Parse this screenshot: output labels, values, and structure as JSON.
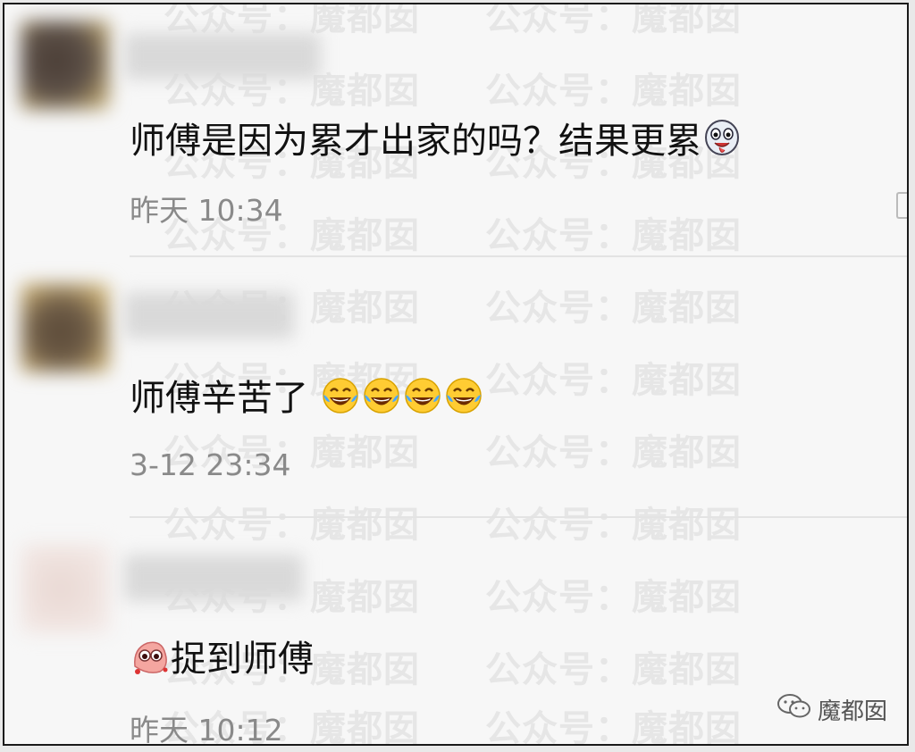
{
  "watermark": "公众号：魔都囡",
  "comments": [
    {
      "text": "师傅是因为累才出家的吗？结果更累",
      "emoji": "ghost-emoji",
      "time": "昨天 10:34"
    },
    {
      "text": "师傅辛苦了",
      "emoji": "tears-of-joy-emoji",
      "emoji_count": 4,
      "time": "3-12 23:34"
    },
    {
      "text": "捉到师傅",
      "emoji": "monster-emoji",
      "time": "昨天 10:12"
    }
  ],
  "brand": {
    "label": "魔都囡",
    "icon": "wechat-icon"
  },
  "colors": {
    "text": "#111111",
    "time": "#8a8a8a",
    "watermark": "#e6e6e6",
    "background": "#f7f7f7"
  }
}
